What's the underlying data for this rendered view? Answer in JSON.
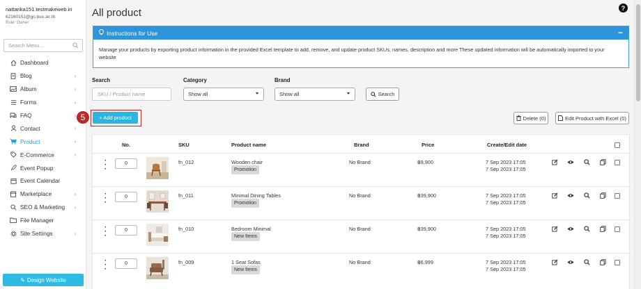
{
  "user": {
    "email": "nattarika151.testmakeweb.in",
    "sub_email": "62160151@go.buu.ac.th",
    "role": "Role: Owner"
  },
  "sidebar": {
    "search_placeholder": "Search Menu...",
    "items": [
      {
        "label": "Dashboard",
        "icon": "home-icon",
        "chevron": false
      },
      {
        "label": "Blog",
        "icon": "document-icon",
        "chevron": true
      },
      {
        "label": "Album",
        "icon": "image-icon",
        "chevron": true
      },
      {
        "label": "Forms",
        "icon": "list-icon",
        "chevron": true
      },
      {
        "label": "FAQ",
        "icon": "chat-icon",
        "chevron": true
      },
      {
        "label": "Contact",
        "icon": "user-icon",
        "chevron": true
      },
      {
        "label": "Product",
        "icon": "cart-icon",
        "chevron": true,
        "active": true
      },
      {
        "label": "E-Commerce",
        "icon": "tag-icon",
        "chevron": true
      },
      {
        "label": "Event Popup",
        "icon": "rocket-icon",
        "chevron": false
      },
      {
        "label": "Event Calendar",
        "icon": "calendar-icon",
        "chevron": false
      },
      {
        "label": "Marketplace",
        "icon": "store-icon",
        "chevron": true
      },
      {
        "label": "SEO & Marketing",
        "icon": "search-icon",
        "chevron": true
      },
      {
        "label": "File Manager",
        "icon": "folder-icon",
        "chevron": false
      },
      {
        "label": "Site Settings",
        "icon": "gear-icon",
        "chevron": true
      }
    ],
    "design_button": "Design Website"
  },
  "page": {
    "title": "All product",
    "help": "?"
  },
  "instructions": {
    "title": "Instructions for Use",
    "collapse": "−",
    "body": "Manage your products by exporting product information in the provided Excel template to add, remove, and update product SKUs, names, description and more These updated information will be automatically imported to your website"
  },
  "filters": {
    "search_label": "Search",
    "search_placeholder": "SKU / Product name",
    "category_label": "Category",
    "category_value": "Show all",
    "brand_label": "Brand",
    "brand_value": "Show all",
    "search_button": "Search"
  },
  "actions": {
    "step": "5",
    "add_product": "+ Add product",
    "delete": "Delete (0)",
    "edit_excel": "Edit Product with Excel (0)"
  },
  "table": {
    "headers": {
      "no": "No.",
      "sku": "SKU",
      "name": "Product name",
      "brand": "Brand",
      "price": "Price",
      "date": "Create/Edit date"
    },
    "rows": [
      {
        "qty": "0",
        "sku": "fn_012",
        "name": "Wooden chair",
        "tag": "Promotion",
        "brand": "No Brand",
        "price": "฿9,900",
        "created": "7 Sep 2023 17:05",
        "edited": "7 Sep 2023 17:05",
        "thumb": "chair"
      },
      {
        "qty": "0",
        "sku": "fn_011",
        "name": "Minimal Dining Tables",
        "tag": "Promotion",
        "brand": "No Brand",
        "price": "฿39,900",
        "created": "7 Sep 2023 17:05",
        "edited": "7 Sep 2023 17:05",
        "thumb": "dining"
      },
      {
        "qty": "0",
        "sku": "fn_010",
        "name": "Bedroom Minimal",
        "tag": "New Items",
        "brand": "No Brand",
        "price": "฿39,900",
        "created": "7 Sep 2023 17:05",
        "edited": "7 Sep 2023 17:05",
        "thumb": "bedroom"
      },
      {
        "qty": "0",
        "sku": "fn_009",
        "name": "1 Seat Sofas",
        "tag": "New Items",
        "brand": "No Brand",
        "price": "฿6,999",
        "created": "7 Sep 2023 17:05",
        "edited": "7 Sep 2023 17:05",
        "thumb": "sofa"
      }
    ]
  },
  "colors": {
    "accent": "#1e9ed8",
    "header_blue": "#2e95dc",
    "add_button": "#2cb5e0",
    "step_red": "#b52a24",
    "tag_gray": "#d9d9d9"
  }
}
